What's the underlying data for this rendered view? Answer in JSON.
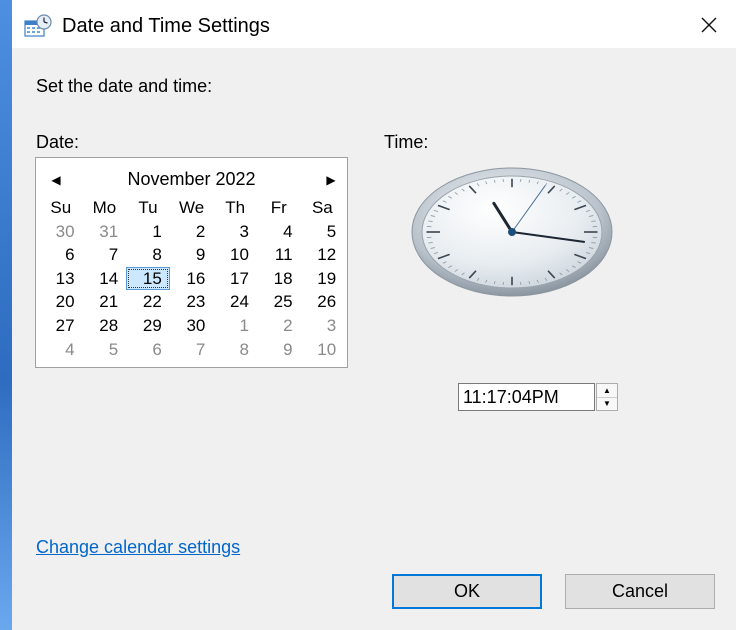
{
  "window": {
    "title": "Date and Time Settings",
    "title_icon": "calendar-clock-icon",
    "close_icon": "close-icon"
  },
  "prompt": "Set the date and time:",
  "date_label": "Date:",
  "time_label": "Time:",
  "calendar": {
    "month_title": "November 2022",
    "prev_icon": "triangle-left-icon",
    "next_icon": "triangle-right-icon",
    "weekdays": [
      "Su",
      "Mo",
      "Tu",
      "We",
      "Th",
      "Fr",
      "Sa"
    ],
    "selected_day": "15",
    "days": [
      {
        "label": "30",
        "other": true
      },
      {
        "label": "31",
        "other": true
      },
      {
        "label": "1"
      },
      {
        "label": "2"
      },
      {
        "label": "3"
      },
      {
        "label": "4"
      },
      {
        "label": "5"
      },
      {
        "label": "6"
      },
      {
        "label": "7"
      },
      {
        "label": "8"
      },
      {
        "label": "9"
      },
      {
        "label": "10"
      },
      {
        "label": "11"
      },
      {
        "label": "12"
      },
      {
        "label": "13"
      },
      {
        "label": "14"
      },
      {
        "label": "15",
        "selected": true
      },
      {
        "label": "16"
      },
      {
        "label": "17"
      },
      {
        "label": "18"
      },
      {
        "label": "19"
      },
      {
        "label": "20"
      },
      {
        "label": "21"
      },
      {
        "label": "22"
      },
      {
        "label": "23"
      },
      {
        "label": "24"
      },
      {
        "label": "25"
      },
      {
        "label": "26"
      },
      {
        "label": "27"
      },
      {
        "label": "28"
      },
      {
        "label": "29"
      },
      {
        "label": "30"
      },
      {
        "label": "1",
        "other": true
      },
      {
        "label": "2",
        "other": true
      },
      {
        "label": "3",
        "other": true
      },
      {
        "label": "4",
        "other": true
      },
      {
        "label": "5",
        "other": true
      },
      {
        "label": "6",
        "other": true
      },
      {
        "label": "7",
        "other": true
      },
      {
        "label": "8",
        "other": true
      },
      {
        "label": "9",
        "other": true
      },
      {
        "label": "10",
        "other": true
      }
    ]
  },
  "clock": {
    "hour": 11,
    "minute": 17,
    "second": 4,
    "icon": "analog-clock-icon"
  },
  "time_field": {
    "value": "11:17:04PM",
    "up_icon": "spin-up-icon",
    "down_icon": "spin-down-icon"
  },
  "links": {
    "change_calendar": "Change calendar settings"
  },
  "buttons": {
    "ok": "OK",
    "cancel": "Cancel"
  },
  "colors": {
    "accent": "#0078d7",
    "link": "#0066cc",
    "selected_day_bg": "#cce8ff",
    "dialog_bg": "#f0f0f0"
  }
}
